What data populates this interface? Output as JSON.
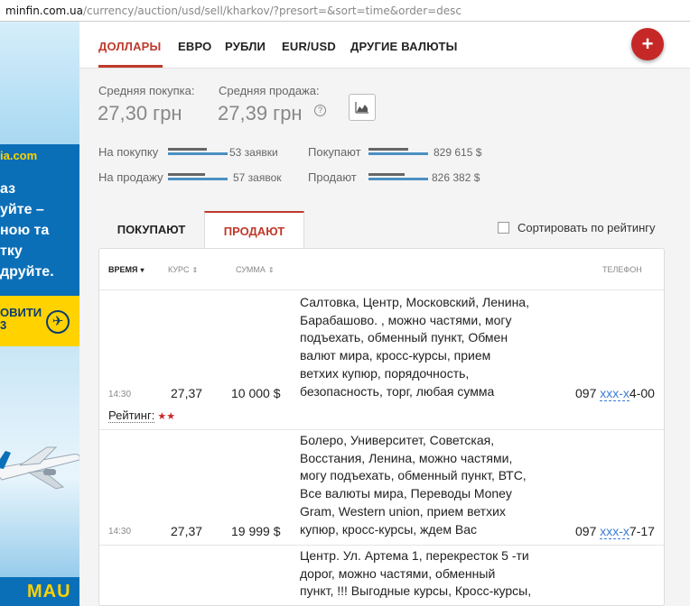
{
  "browser": {
    "url_host": "minfin.com.ua",
    "url_path": "/currency/auction/usd/sell/kharkov/?presort=&sort=time&order=desc"
  },
  "ad": {
    "site": "ia.com",
    "promo_lines": [
      "аз",
      "уйте –",
      "ною та",
      "тку",
      "друйте."
    ],
    "cta_line1": "ОВИТИ",
    "cta_line2": "3",
    "logo": "MAU"
  },
  "nav": {
    "items": [
      "ДОЛЛАРЫ",
      "ЕВРО",
      "РУБЛИ",
      "EUR/USD",
      "ДРУГИЕ ВАЛЮТЫ"
    ],
    "add_label": "+"
  },
  "rates": {
    "avg_buy_label": "Средняя покупка:",
    "avg_buy_value": "27,30 грн",
    "avg_sell_label": "Средняя продажа:",
    "avg_sell_value": "27,39 грн",
    "help_glyph": "?"
  },
  "stats": {
    "buy_label": "На покупку",
    "buy_count": "53 заявки",
    "sell_label": "На продажу",
    "sell_count": "57 заявок",
    "buyers_label": "Покупают",
    "buyers_amount": "829 615 $",
    "sellers_label": "Продают",
    "sellers_amount": "826 382 $",
    "bar_fill": {
      "buy": [
        0.65,
        1.0
      ],
      "sell": [
        0.62,
        1.0
      ],
      "buyers": [
        0.66,
        1.0
      ],
      "sellers": [
        0.6,
        1.0
      ]
    }
  },
  "tabs": {
    "buy": "ПОКУПАЮТ",
    "sell": "ПРОДАЮТ",
    "sort_by_rating": "Сортировать по рейтингу"
  },
  "table": {
    "headers": {
      "time": "ВРЕМЯ",
      "rate": "КУРС",
      "sum": "СУММА",
      "phone": "ТЕЛЕФОН"
    },
    "rows": [
      {
        "time": "14:30",
        "rate": "27,37",
        "sum": "10 000 $",
        "desc": [
          "Салтовка, Центр, Московский, Ленина,",
          "Барабашово. , можно частями, могу",
          "подъехать, обменный пункт, Обмен",
          "валют мира, кросс-курсы, прием",
          "ветхих купюр, порядочность,",
          "безопасность, торг, любая сумма"
        ],
        "phone_prefix": "097 ",
        "phone_hidden": "ххх-х",
        "phone_suffix": "4-00",
        "rating_label": "Рейтинг:",
        "rating_stars": "★★"
      },
      {
        "time": "14:30",
        "rate": "27,37",
        "sum": "19 999 $",
        "desc": [
          "Болеро, Университет, Советская,",
          "Восстания, Ленина, можно частями,",
          "могу подъехать, обменный пункт, ВТС,",
          "Все валюты мира, Переводы Money",
          "Gram, Western union, прием ветхих",
          "купюр, кросс-курсы, ждем Вас"
        ],
        "phone_prefix": "097 ",
        "phone_hidden": "ххх-х",
        "phone_suffix": "7-17"
      },
      {
        "desc": [
          "Центр. Ул. Артема 1, перекресток 5 -ти",
          "дорог, можно частями, обменный",
          "пункт, !!! Выгодные курсы, Кросс-курсы,"
        ]
      }
    ]
  }
}
